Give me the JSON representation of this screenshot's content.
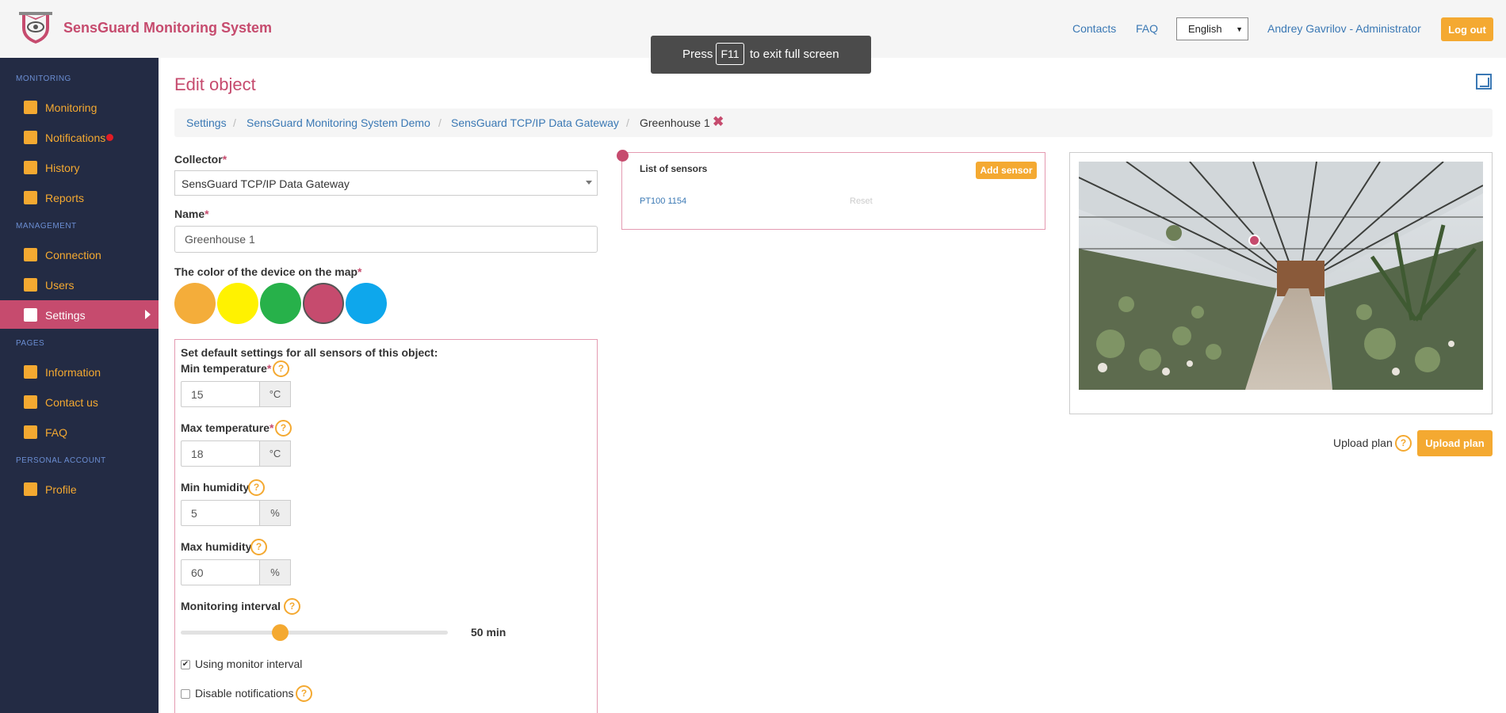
{
  "header": {
    "brand": "SensGuard Monitoring System",
    "links": {
      "contacts": "Contacts",
      "faq": "FAQ"
    },
    "language": "English",
    "user": "Andrey Gavrilov - Administrator",
    "logout": "Log out"
  },
  "toast": {
    "before": "Press",
    "key": "F11",
    "after": "to exit full screen"
  },
  "sidebar": {
    "sections": {
      "monitoring": "MONITORING",
      "management": "MANAGEMENT",
      "pages": "PAGES",
      "personal": "PERSONAL ACCOUNT"
    },
    "items": {
      "monitoring": "Monitoring",
      "notifications": "Notifications",
      "history": "History",
      "reports": "Reports",
      "connection": "Connection",
      "users": "Users",
      "settings": "Settings",
      "information": "Information",
      "contact_us": "Contact us",
      "faq": "FAQ",
      "profile": "Profile"
    },
    "accent": "#f4a931",
    "active_color": "#c64b6e"
  },
  "page": {
    "title": "Edit object"
  },
  "breadcrumb": {
    "settings": "Settings",
    "demo": "SensGuard Monitoring System Demo",
    "gateway": "SensGuard TCP/IP Data Gateway",
    "current": "Greenhouse 1",
    "separator": "/"
  },
  "form": {
    "collector_label": "Collector",
    "collector_value": "SensGuard TCP/IP Data Gateway",
    "name_label": "Name",
    "name_value": "Greenhouse 1",
    "color_label": "The color of the device on the map",
    "required_mark": "*",
    "colors": [
      "#f4ad3a",
      "#fff200",
      "#27b14a",
      "#c64b6e",
      "#0ea7ec"
    ],
    "selected_color": "#c64b6e"
  },
  "defaults": {
    "title": "Set default settings for all sensors of this object:",
    "min_temp_label": "Min temperature",
    "min_temp": "15",
    "max_temp_label": "Max temperature",
    "max_temp": "18",
    "temp_unit": "°C",
    "min_hum_label": "Min humidity",
    "min_hum": "5",
    "max_hum_label": "Max humidity",
    "max_hum": "60",
    "hum_unit": "%",
    "interval_label": "Monitoring interval",
    "interval_value": "50 min",
    "interval_fraction": 0.37,
    "using_interval_label": "Using monitor interval",
    "using_interval_checked": true,
    "disable_notif_label": "Disable notifications",
    "disable_notif_checked": false,
    "help": "?"
  },
  "sensors": {
    "title": "List of sensors",
    "add": "Add sensor",
    "items": [
      {
        "name": "PT100 1154",
        "action": "Reset"
      }
    ]
  },
  "plan": {
    "upload_label": "Upload plan",
    "upload_button": "Upload plan"
  }
}
